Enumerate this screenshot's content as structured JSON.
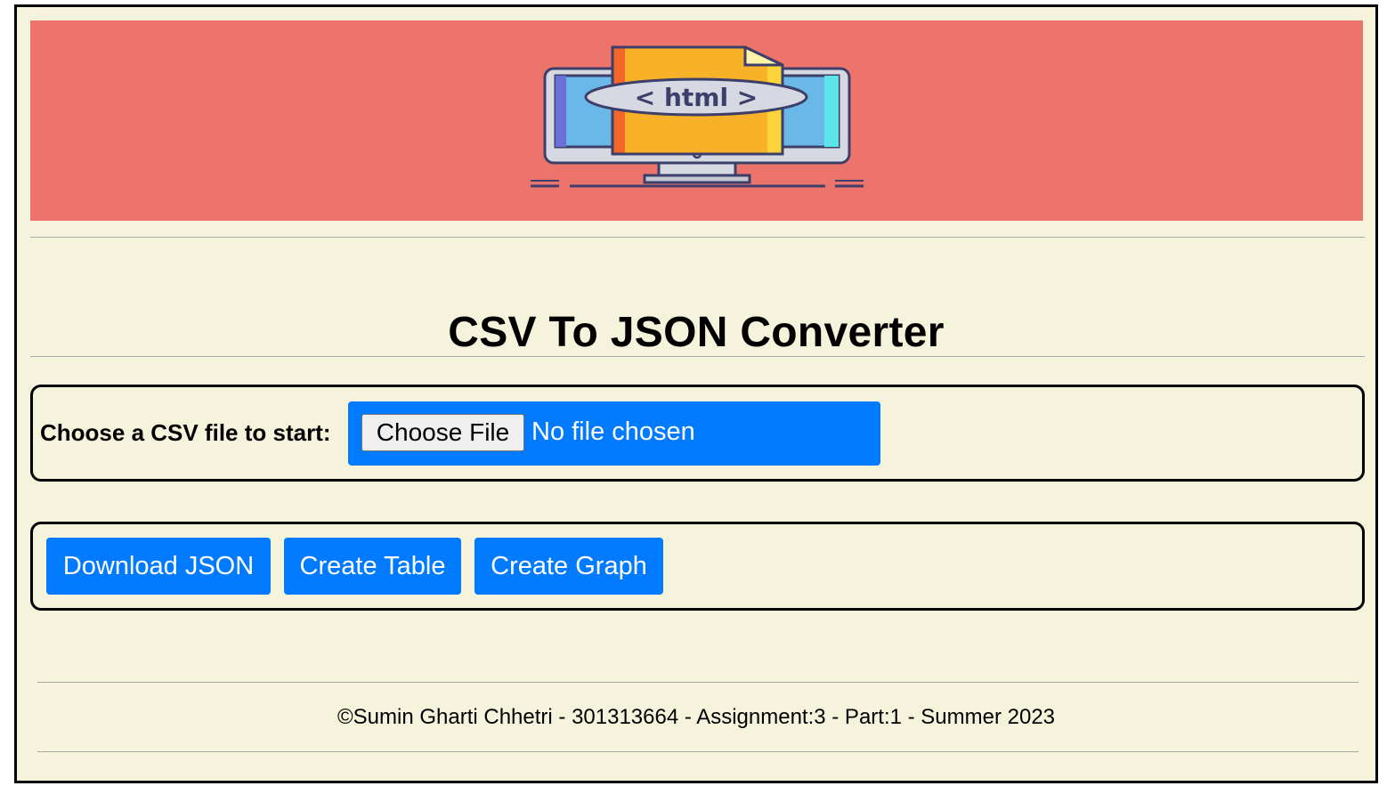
{
  "header": {
    "banner_icon": "html-monitor-icon",
    "banner_icon_text": "< html >",
    "banner_color": "#ed746b"
  },
  "main": {
    "title": "CSV To JSON Converter",
    "file_panel": {
      "label": "Choose a CSV file to start:",
      "choose_button": "Choose File",
      "status": "No file chosen"
    },
    "actions": {
      "download_json": "Download JSON",
      "create_table": "Create Table",
      "create_graph": "Create Graph"
    }
  },
  "footer": {
    "text": "©Sumin Gharti Chhetri - 301313664 - Assignment:3 - Part:1 - Summer 2023"
  },
  "colors": {
    "background": "#f5f3dc",
    "accent": "#007bff"
  }
}
